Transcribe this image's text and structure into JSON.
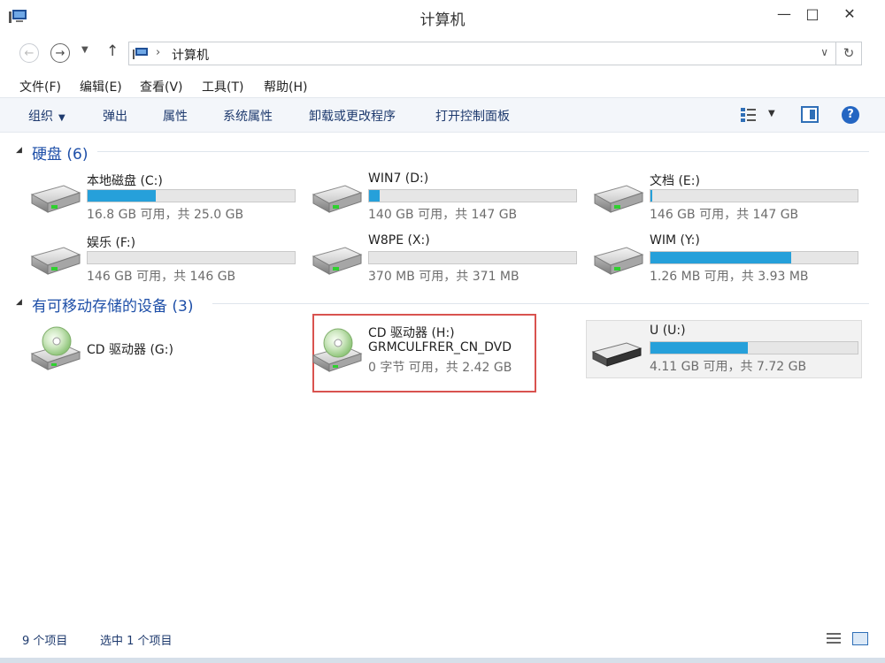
{
  "window": {
    "title": "计算机"
  },
  "address": {
    "path": "计算机"
  },
  "menu": [
    "文件(F)",
    "编辑(E)",
    "查看(V)",
    "工具(T)",
    "帮助(H)"
  ],
  "toolbar": {
    "organize": "组织",
    "eject": "弹出",
    "properties": "属性",
    "system_properties": "系统属性",
    "uninstall": "卸载或更改程序",
    "control_panel": "打开控制面板"
  },
  "groups": {
    "hdd": "硬盘 (6)",
    "removable": "有可移动存储的设备 (3)"
  },
  "drives": [
    {
      "name": "本地磁盘 (C:)",
      "info": "16.8 GB 可用，共 25.0 GB",
      "used_fraction": 0.33
    },
    {
      "name": "WIN7 (D:)",
      "info": "140 GB 可用，共 147 GB",
      "used_fraction": 0.05
    },
    {
      "name": "文档 (E:)",
      "info": "146 GB 可用，共 147 GB",
      "used_fraction": 0.01
    },
    {
      "name": "娱乐 (F:)",
      "info": "146 GB 可用，共 146 GB",
      "used_fraction": 0.0
    },
    {
      "name": "W8PE (X:)",
      "info": "370 MB 可用，共 371 MB",
      "used_fraction": 0.0
    },
    {
      "name": "WIM (Y:)",
      "info": "1.26 MB 可用，共 3.93 MB",
      "used_fraction": 0.68
    }
  ],
  "removable": [
    {
      "name": "CD 驱动器 (G:)"
    },
    {
      "name": "CD 驱动器 (H:)",
      "label": "GRMCULFRER_CN_DVD",
      "info": "0 字节 可用，共 2.42 GB"
    },
    {
      "name": "U (U:)",
      "info": "4.11 GB 可用，共 7.72 GB",
      "used_fraction": 0.47
    }
  ],
  "status": {
    "count": "9 个项目",
    "selected": "选中 1 个项目"
  },
  "colors": {
    "accent": "#26a0da",
    "group_title": "#1e4fa8",
    "selection_border": "#d9534f"
  }
}
